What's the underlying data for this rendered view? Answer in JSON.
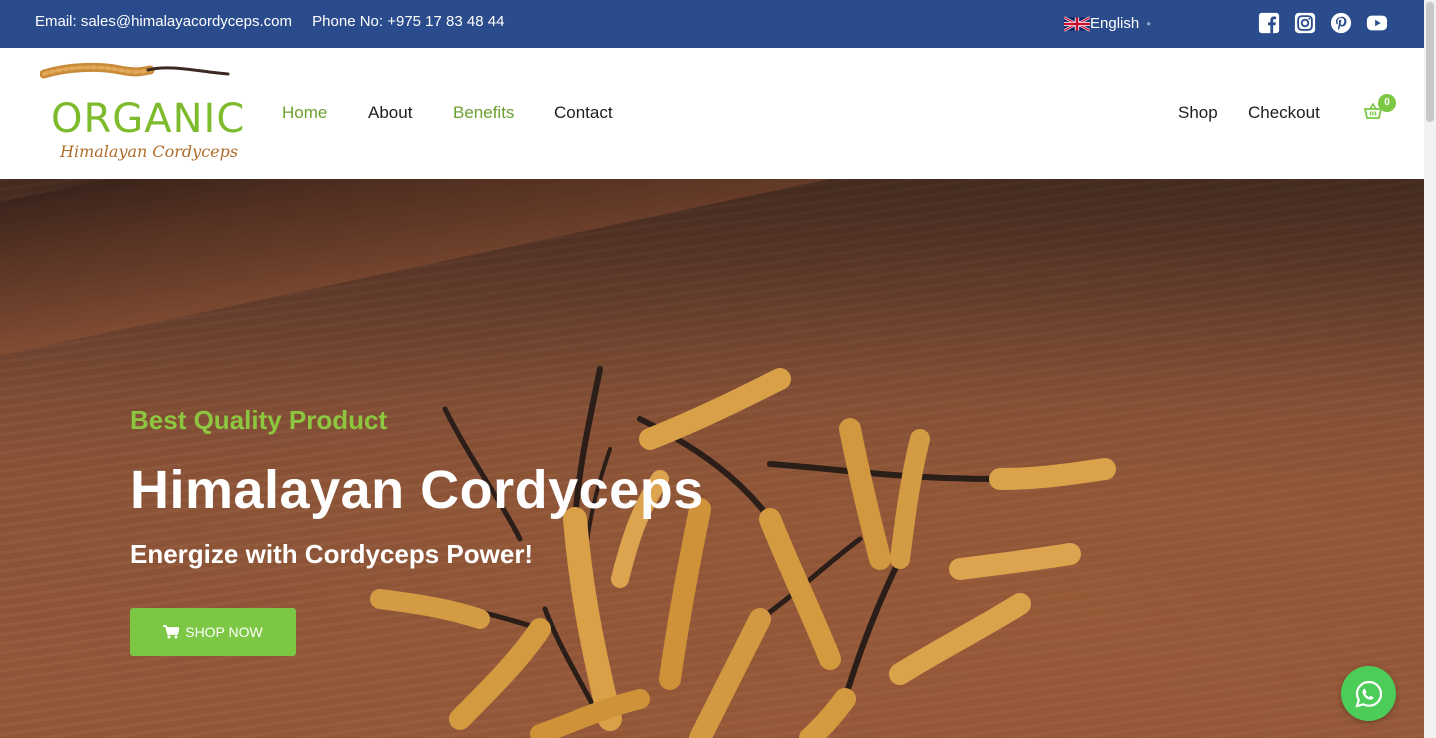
{
  "topbar": {
    "email": "Email: sales@himalayacordyceps.com",
    "phone": "Phone No: +975 17 83 48 44",
    "language": "English",
    "socials": [
      "facebook-icon",
      "instagram-icon",
      "pinterest-icon",
      "youtube-icon"
    ]
  },
  "logo": {
    "word": "ORGANIC",
    "subtitle": "Himalayan Cordyceps"
  },
  "nav": {
    "left": [
      {
        "label": "Home",
        "active": true
      },
      {
        "label": "About",
        "active": false
      },
      {
        "label": "Benefits",
        "active": true
      },
      {
        "label": "Contact",
        "active": false
      }
    ],
    "right": [
      {
        "label": "Shop"
      },
      {
        "label": "Checkout"
      }
    ],
    "cart_count": "0"
  },
  "hero": {
    "kicker": "Best Quality Product",
    "title": "Himalayan Cordyceps",
    "subtitle": "Energize with Cordyceps Power!",
    "button_label": "SHOP NOW"
  },
  "colors": {
    "topbar": "#2b4c8c",
    "accent_green": "#7cc744",
    "nav_active": "#6aa130",
    "whatsapp": "#4ccc58"
  }
}
